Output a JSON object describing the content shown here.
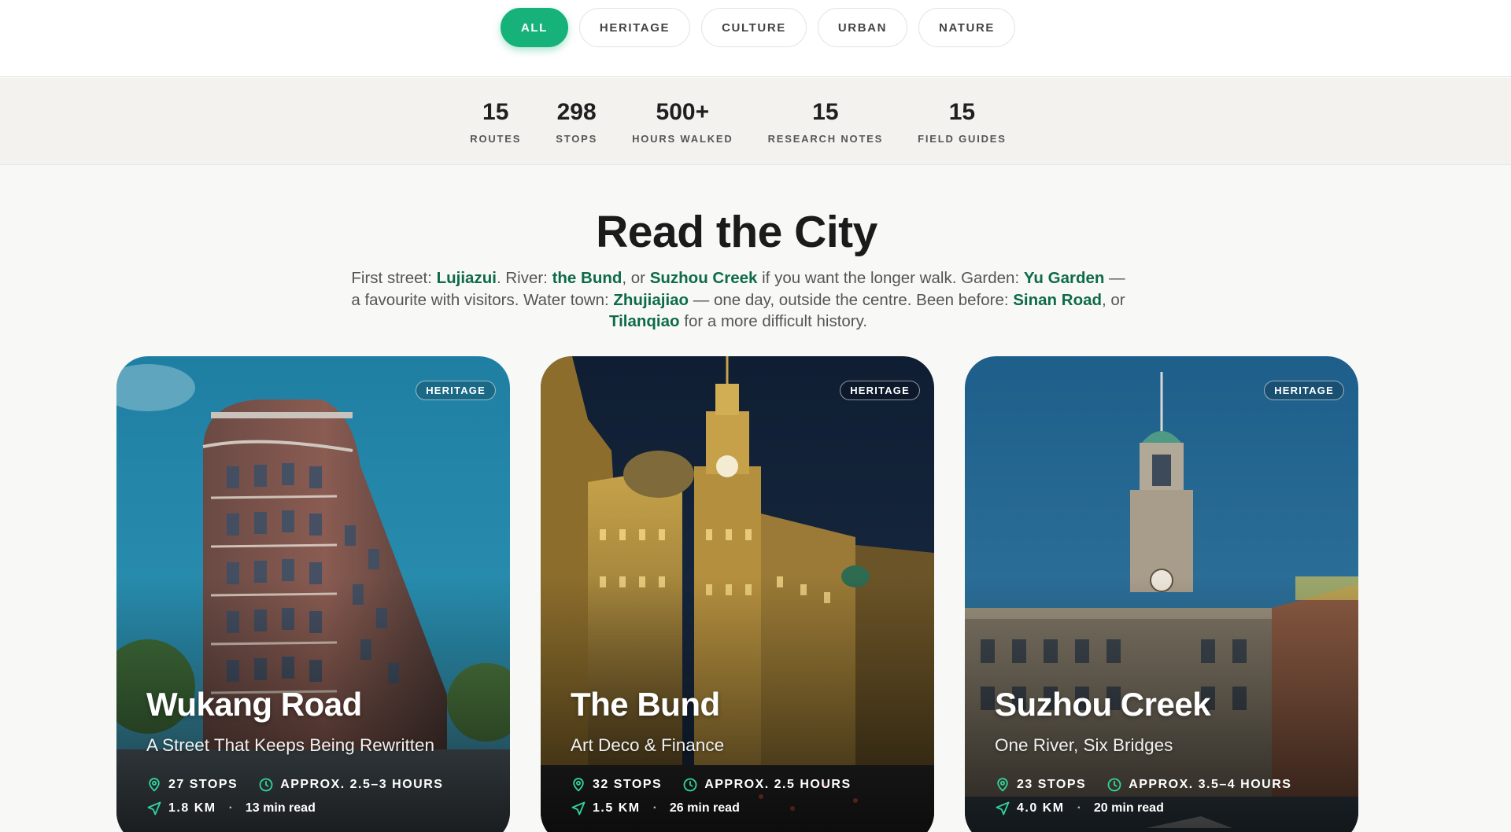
{
  "filters": [
    {
      "label": "ALL",
      "active": true
    },
    {
      "label": "HERITAGE",
      "active": false
    },
    {
      "label": "CULTURE",
      "active": false
    },
    {
      "label": "URBAN",
      "active": false
    },
    {
      "label": "NATURE",
      "active": false
    }
  ],
  "stats": [
    {
      "value": "15",
      "label": "ROUTES"
    },
    {
      "value": "298",
      "label": "STOPS"
    },
    {
      "value": "500+",
      "label": "HOURS WALKED"
    },
    {
      "value": "15",
      "label": "RESEARCH NOTES"
    },
    {
      "value": "15",
      "label": "FIELD GUIDES"
    }
  ],
  "intro": {
    "title": "Read the City",
    "segments": [
      {
        "text": "First street: "
      },
      {
        "text": "Lujiazui",
        "link": true
      },
      {
        "text": ". River: "
      },
      {
        "text": "the Bund",
        "link": true
      },
      {
        "text": ", or "
      },
      {
        "text": "Suzhou Creek",
        "link": true
      },
      {
        "text": " if you want the longer walk. Garden: "
      },
      {
        "text": "Yu Garden",
        "link": true
      },
      {
        "text": " — a favourite with visitors. Water town: "
      },
      {
        "text": "Zhujiajiao",
        "link": true
      },
      {
        "text": " — one day, outside the centre. Been before: "
      },
      {
        "text": "Sinan Road",
        "link": true
      },
      {
        "text": ", or "
      },
      {
        "text": "Tilanqiao",
        "link": true
      },
      {
        "text": " for a more difficult history."
      }
    ]
  },
  "cards": [
    {
      "badge": "HERITAGE",
      "title": "Wukang Road",
      "subtitle": "A Street That Keeps Being Rewritten",
      "stops": "27 STOPS",
      "duration": "APPROX. 2.5–3 HOURS",
      "distance": "1.8 KM",
      "read": "13 min read"
    },
    {
      "badge": "HERITAGE",
      "title": "The Bund",
      "subtitle": "Art Deco & Finance",
      "stops": "32 STOPS",
      "duration": "APPROX. 2.5 HOURS",
      "distance": "1.5 KM",
      "read": "26 min read"
    },
    {
      "badge": "HERITAGE",
      "title": "Suzhou Creek",
      "subtitle": "One River, Six Bridges",
      "stops": "23 STOPS",
      "duration": "APPROX. 3.5–4 HOURS",
      "distance": "4.0 KM",
      "read": "20 min read"
    }
  ],
  "colors": {
    "accent": "#17b27a",
    "link": "#0d6b49"
  },
  "icons": {
    "stops": "map-pin-icon",
    "duration": "clock-icon",
    "distance": "navigation-arrow-icon"
  }
}
